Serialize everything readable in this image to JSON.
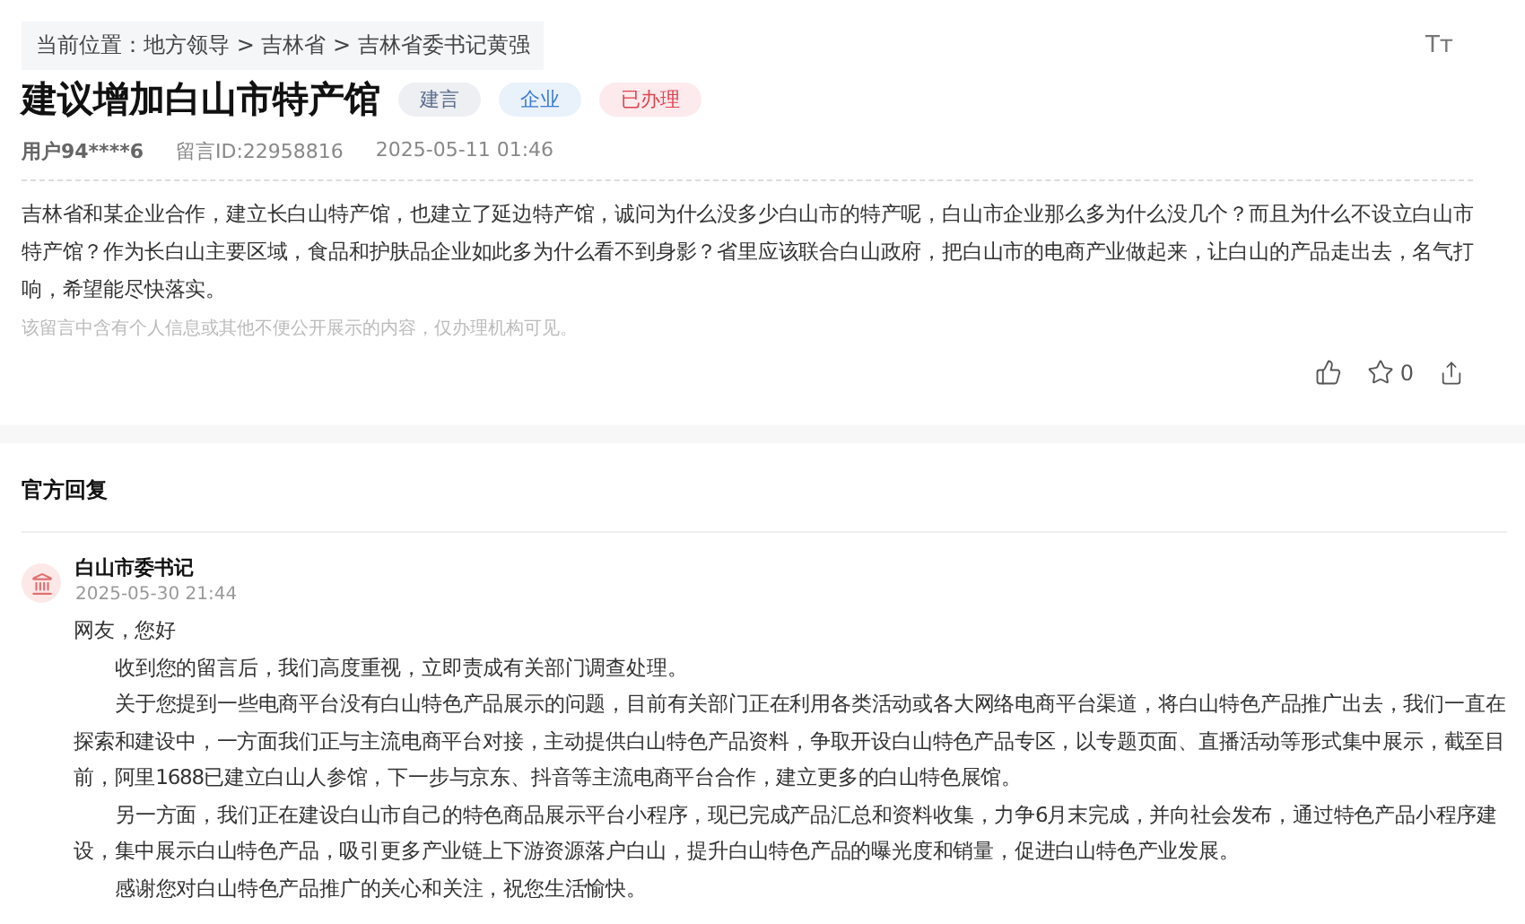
{
  "breadcrumb": "当前位置：地方领导 > 吉林省 > 吉林省委书记黄强",
  "font_size_button": "Tт",
  "title": "建议增加白山市特产馆",
  "tags": [
    {
      "label": "建言",
      "color": "#5b6b8c"
    },
    {
      "label": "企业",
      "color": "#3a7bd5"
    },
    {
      "label": "已办理",
      "color": "#e0434f"
    }
  ],
  "meta": {
    "user": "用户94****6",
    "message_id": "留言ID:22958816",
    "time": "2025-05-11 01:46"
  },
  "body": "吉林省和某企业合作，建立长白山特产馆，也建立了延边特产馆，诚问为什么没多少白山市的特产呢，白山市企业那么多为什么没几个？而且为什么不设立白山市特产馆？作为长白山主要区域，食品和护肤品企业如此多为什么看不到身影？省里应该联合白山政府，把白山市的电商产业做起来，让白山的产品走出去，名气打响，希望能尽快落实。",
  "notice": "该留言中含有个人信息或其他不便公开展示的内容，仅办理机构可见。",
  "actions": {
    "favorites": "0"
  },
  "reply_section": {
    "heading": "官方回复",
    "author": "白山市委书记",
    "time": "2025-05-30 21:44",
    "greeting": "网友，您好",
    "paragraphs": [
      "收到您的留言后，我们高度重视，立即责成有关部门调查处理。",
      "关于您提到一些电商平台没有白山特色产品展示的问题，目前有关部门正在利用各类活动或各大网络电商平台渠道，将白山特色产品推广出去，我们一直在探索和建设中，一方面我们正与主流电商平台对接，主动提供白山特色产品资料，争取开设白山特色产品专区，以专题页面、直播活动等形式集中展示，截至目前，阿里1688已建立白山人参馆，下一步与京东、抖音等主流电商平台合作，建立更多的白山特色展馆。",
      "另一方面，我们正在建设白山市自己的特色商品展示平台小程序，现已完成产品汇总和资料收集，力争6月末完成，并向社会发布，通过特色产品小程序建设，集中展示白山特色产品，吸引更多产业链上下游资源落户白山，提升白山特色产品的曝光度和销量，促进白山特色产业发展。",
      "感谢您对白山特色产品推广的关心和关注，祝您生活愉快。"
    ]
  }
}
